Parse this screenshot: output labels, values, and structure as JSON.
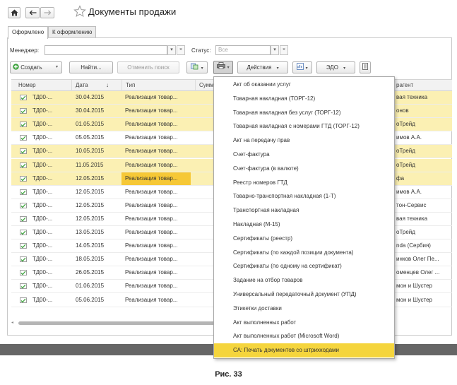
{
  "header": {
    "title": "Документы продажи"
  },
  "tabs": [
    {
      "label": "Оформлено",
      "active": true
    },
    {
      "label": "К оформлению",
      "active": false
    }
  ],
  "filters": {
    "manager_label": "Менеджер:",
    "manager_value": "",
    "status_label": "Статус:",
    "status_placeholder": "Все"
  },
  "toolbar": {
    "create_label": "Создать",
    "find_label": "Найти...",
    "cancel_search_label": "Отменить поиск",
    "actions_label": "Действия",
    "edo_label": "ЭДО"
  },
  "table": {
    "columns": [
      "Номер",
      "Дата",
      "Тип",
      "Сумм",
      "рагент"
    ],
    "sort_indicator": "↓",
    "rows": [
      {
        "number": "ТД00-...",
        "date": "30.04.2015",
        "type": "Реализация товар...",
        "partner": "вая техника",
        "highlight": true
      },
      {
        "number": "ТД00-...",
        "date": "30.04.2015",
        "type": "Реализация товар...",
        "partner": "онов",
        "highlight": true
      },
      {
        "number": "ТД00-...",
        "date": "01.05.2015",
        "type": "Реализация товар...",
        "partner": "оТрейд",
        "highlight": true
      },
      {
        "number": "ТД00-...",
        "date": "05.05.2015",
        "type": "Реализация товар...",
        "partner": "имов А.А.",
        "highlight": false
      },
      {
        "number": "ТД00-...",
        "date": "10.05.2015",
        "type": "Реализация товар...",
        "partner": "оТрейд",
        "highlight": true
      },
      {
        "number": "ТД00-...",
        "date": "11.05.2015",
        "type": "Реализация товар...",
        "partner": "оТрейд",
        "highlight": true
      },
      {
        "number": "ТД00-...",
        "date": "12.05.2015",
        "type": "Реализация товар...",
        "partner": "фа",
        "highlight": true,
        "selected": true
      },
      {
        "number": "ТД00-...",
        "date": "12.05.2015",
        "type": "Реализация товар...",
        "partner": "имов А.А.",
        "highlight": false
      },
      {
        "number": "ТД00-...",
        "date": "12.05.2015",
        "type": "Реализация товар...",
        "partner": "тон-Сервис",
        "highlight": false
      },
      {
        "number": "ТД00-...",
        "date": "12.05.2015",
        "type": "Реализация товар...",
        "partner": "вая техника",
        "highlight": false
      },
      {
        "number": "ТД00-...",
        "date": "13.05.2015",
        "type": "Реализация товар...",
        "partner": "оТрейд",
        "highlight": false
      },
      {
        "number": "ТД00-...",
        "date": "14.05.2015",
        "type": "Реализация товар...",
        "partner": "nda (Сербия)",
        "highlight": false
      },
      {
        "number": "ТД00-...",
        "date": "18.05.2015",
        "type": "Реализация товар...",
        "partner": "инков Олег Пе...",
        "highlight": false
      },
      {
        "number": "ТД00-...",
        "date": "26.05.2015",
        "type": "Реализация товар...",
        "partner": "оменцев Олег ...",
        "highlight": false
      },
      {
        "number": "ТД00-...",
        "date": "01.06.2015",
        "type": "Реализация товар...",
        "partner": "мон и Шустер",
        "highlight": false
      },
      {
        "number": "ТД00-...",
        "date": "05.06.2015",
        "type": "Реализация товар...",
        "partner": "мон и Шустер",
        "highlight": false
      }
    ]
  },
  "print_menu": {
    "items": [
      "Акт об оказании услуг",
      "Товарная накладная (ТОРГ-12)",
      "Товарная накладная без услуг (ТОРГ-12)",
      "Товарная накладная с номерами ГТД (ТОРГ-12)",
      "Акт на передачу прав",
      "Счет-фактура",
      "Счет-фактура (в валюте)",
      "Реестр номеров ГТД",
      "Товарно-транспортная накладная (1-Т)",
      "Транспортная накладная",
      "Накладная (М-15)",
      "Сертификаты (реестр)",
      "Сертификаты (по каждой позиции документа)",
      "Сертификаты (по одному на сертификат)",
      "Задание на отбор товаров",
      "Универсальный передаточный документ (УПД)",
      "Этикетки доставки",
      "Акт выполненных работ",
      "Акт выполненных работ (Microsoft Word)",
      "СА: Печать документов со штрихкодами"
    ],
    "hovered_index": 19
  },
  "caption": "Рис. 33",
  "colors": {
    "row_highlight": "#fbf0b3",
    "selection": "#f6c836",
    "menu_hover": "#f5d53d",
    "create_icon": "#3fa33f"
  }
}
